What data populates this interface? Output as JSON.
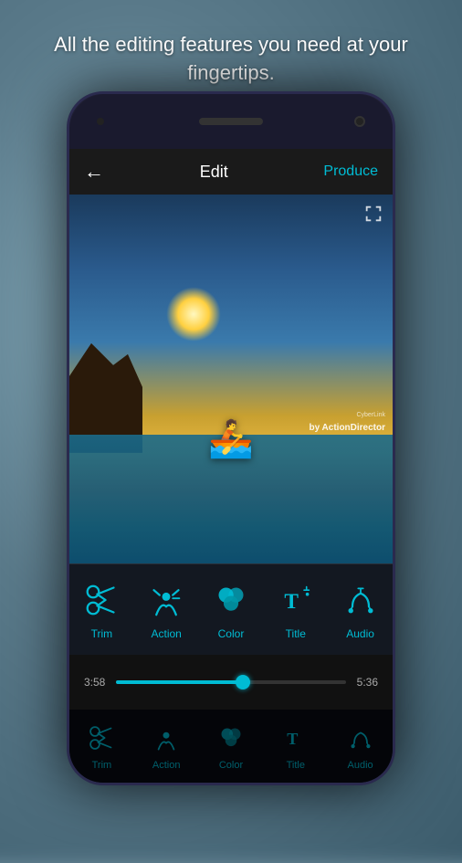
{
  "header": {
    "tagline": "All the editing features you need at your fingertips."
  },
  "phone": {
    "edit_screen": {
      "title": "Edit",
      "back_label": "←",
      "produce_label": "Produce",
      "fullscreen_label": "⛶"
    },
    "watermark": {
      "by_text": "CyberLink",
      "brand": "by ActionDirector"
    },
    "toolbar": {
      "items": [
        {
          "id": "trim",
          "label": "Trim",
          "icon": "scissors"
        },
        {
          "id": "action",
          "label": "Action",
          "icon": "action"
        },
        {
          "id": "color",
          "label": "Color",
          "icon": "color"
        },
        {
          "id": "title",
          "label": "Title",
          "icon": "title"
        },
        {
          "id": "audio",
          "label": "Audio",
          "icon": "audio"
        }
      ]
    },
    "timeline": {
      "start_time": "3:58",
      "end_time": "5:36",
      "progress": 55
    }
  }
}
